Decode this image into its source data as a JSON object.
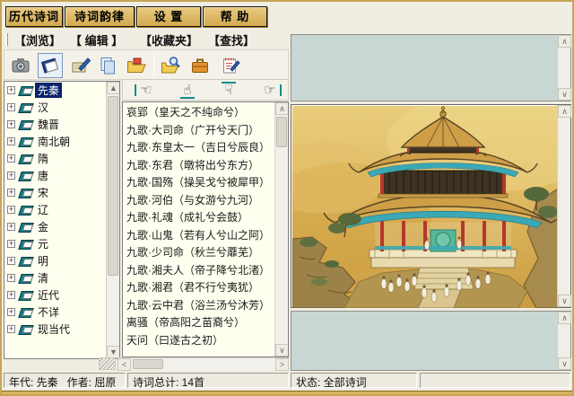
{
  "glyphs": {
    "plus": "+",
    "up": "▲",
    "down": "▼",
    "chev_up": "∧",
    "chev_down": "∨",
    "left": "<",
    "right": ">"
  },
  "menu": {
    "items": [
      "历代诗词",
      "诗词韵律",
      "设 置",
      "帮 助"
    ]
  },
  "tabs": {
    "items": [
      "【浏览】",
      "【 编辑 】",
      "【收藏夹】",
      "【查找】"
    ]
  },
  "toolbar": {
    "icons": [
      "camera",
      "book",
      "write",
      "copy",
      "open-folder",
      "search-folder",
      "briefcase",
      "notepad"
    ],
    "selected_icon": "book"
  },
  "nav": {
    "first": "☜",
    "prev": "☝",
    "next": "☟",
    "last": "☞"
  },
  "tree": {
    "selected": "先秦",
    "items": [
      "先秦",
      "汉",
      "魏晋",
      "南北朝",
      "隋",
      "唐",
      "宋",
      "辽",
      "金",
      "元",
      "明",
      "清",
      "近代",
      "不详",
      "现当代"
    ]
  },
  "poems": {
    "items": [
      "哀郢（皇天之不纯命兮）",
      "九歌·大司命（广开兮天门）",
      "九歌·东皇太一（吉日兮辰良）",
      "九歌·东君（暾将出兮东方）",
      "九歌·国殇（操吴戈兮被犀甲）",
      "九歌·河伯（与女游兮九河）",
      "九歌·礼魂（成礼兮会鼓）",
      "九歌·山鬼（若有人兮山之阿）",
      "九歌·少司命（秋兰兮蘼芜）",
      "九歌·湘夫人（帝子降兮北渚）",
      "九歌·湘君（君不行兮夷犹）",
      "九歌·云中君（浴兰汤兮沐芳）",
      "离骚（帝高阳之苗裔兮）",
      "天问（曰遂古之初）"
    ]
  },
  "painting": {
    "name": "pavilion-landscape-painting"
  },
  "status": {
    "era": "年代: 先秦",
    "author": "作者: 屈原",
    "total": "诗词总计: 14首",
    "state": "状态: 全部诗词"
  },
  "colors": {
    "frame": "#C7A557",
    "menu_button": "#D9B269",
    "list_bg": "#FFFFEF",
    "selection": "#0A246A",
    "teal_area": "#C8D7D4",
    "accent_teal": "#0E8C8C",
    "painting_gold": "#D9AE52"
  }
}
